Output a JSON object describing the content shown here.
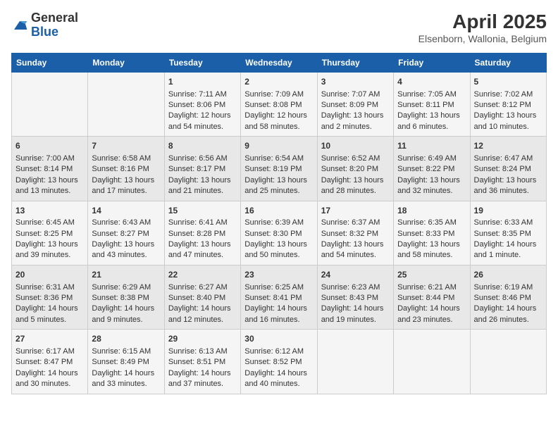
{
  "logo": {
    "general": "General",
    "blue": "Blue"
  },
  "title": "April 2025",
  "subtitle": "Elsenborn, Wallonia, Belgium",
  "days_of_week": [
    "Sunday",
    "Monday",
    "Tuesday",
    "Wednesday",
    "Thursday",
    "Friday",
    "Saturday"
  ],
  "weeks": [
    [
      {
        "day": "",
        "content": ""
      },
      {
        "day": "",
        "content": ""
      },
      {
        "day": "1",
        "content": "Sunrise: 7:11 AM\nSunset: 8:06 PM\nDaylight: 12 hours\nand 54 minutes."
      },
      {
        "day": "2",
        "content": "Sunrise: 7:09 AM\nSunset: 8:08 PM\nDaylight: 12 hours\nand 58 minutes."
      },
      {
        "day": "3",
        "content": "Sunrise: 7:07 AM\nSunset: 8:09 PM\nDaylight: 13 hours\nand 2 minutes."
      },
      {
        "day": "4",
        "content": "Sunrise: 7:05 AM\nSunset: 8:11 PM\nDaylight: 13 hours\nand 6 minutes."
      },
      {
        "day": "5",
        "content": "Sunrise: 7:02 AM\nSunset: 8:12 PM\nDaylight: 13 hours\nand 10 minutes."
      }
    ],
    [
      {
        "day": "6",
        "content": "Sunrise: 7:00 AM\nSunset: 8:14 PM\nDaylight: 13 hours\nand 13 minutes."
      },
      {
        "day": "7",
        "content": "Sunrise: 6:58 AM\nSunset: 8:16 PM\nDaylight: 13 hours\nand 17 minutes."
      },
      {
        "day": "8",
        "content": "Sunrise: 6:56 AM\nSunset: 8:17 PM\nDaylight: 13 hours\nand 21 minutes."
      },
      {
        "day": "9",
        "content": "Sunrise: 6:54 AM\nSunset: 8:19 PM\nDaylight: 13 hours\nand 25 minutes."
      },
      {
        "day": "10",
        "content": "Sunrise: 6:52 AM\nSunset: 8:20 PM\nDaylight: 13 hours\nand 28 minutes."
      },
      {
        "day": "11",
        "content": "Sunrise: 6:49 AM\nSunset: 8:22 PM\nDaylight: 13 hours\nand 32 minutes."
      },
      {
        "day": "12",
        "content": "Sunrise: 6:47 AM\nSunset: 8:24 PM\nDaylight: 13 hours\nand 36 minutes."
      }
    ],
    [
      {
        "day": "13",
        "content": "Sunrise: 6:45 AM\nSunset: 8:25 PM\nDaylight: 13 hours\nand 39 minutes."
      },
      {
        "day": "14",
        "content": "Sunrise: 6:43 AM\nSunset: 8:27 PM\nDaylight: 13 hours\nand 43 minutes."
      },
      {
        "day": "15",
        "content": "Sunrise: 6:41 AM\nSunset: 8:28 PM\nDaylight: 13 hours\nand 47 minutes."
      },
      {
        "day": "16",
        "content": "Sunrise: 6:39 AM\nSunset: 8:30 PM\nDaylight: 13 hours\nand 50 minutes."
      },
      {
        "day": "17",
        "content": "Sunrise: 6:37 AM\nSunset: 8:32 PM\nDaylight: 13 hours\nand 54 minutes."
      },
      {
        "day": "18",
        "content": "Sunrise: 6:35 AM\nSunset: 8:33 PM\nDaylight: 13 hours\nand 58 minutes."
      },
      {
        "day": "19",
        "content": "Sunrise: 6:33 AM\nSunset: 8:35 PM\nDaylight: 14 hours\nand 1 minute."
      }
    ],
    [
      {
        "day": "20",
        "content": "Sunrise: 6:31 AM\nSunset: 8:36 PM\nDaylight: 14 hours\nand 5 minutes."
      },
      {
        "day": "21",
        "content": "Sunrise: 6:29 AM\nSunset: 8:38 PM\nDaylight: 14 hours\nand 9 minutes."
      },
      {
        "day": "22",
        "content": "Sunrise: 6:27 AM\nSunset: 8:40 PM\nDaylight: 14 hours\nand 12 minutes."
      },
      {
        "day": "23",
        "content": "Sunrise: 6:25 AM\nSunset: 8:41 PM\nDaylight: 14 hours\nand 16 minutes."
      },
      {
        "day": "24",
        "content": "Sunrise: 6:23 AM\nSunset: 8:43 PM\nDaylight: 14 hours\nand 19 minutes."
      },
      {
        "day": "25",
        "content": "Sunrise: 6:21 AM\nSunset: 8:44 PM\nDaylight: 14 hours\nand 23 minutes."
      },
      {
        "day": "26",
        "content": "Sunrise: 6:19 AM\nSunset: 8:46 PM\nDaylight: 14 hours\nand 26 minutes."
      }
    ],
    [
      {
        "day": "27",
        "content": "Sunrise: 6:17 AM\nSunset: 8:47 PM\nDaylight: 14 hours\nand 30 minutes."
      },
      {
        "day": "28",
        "content": "Sunrise: 6:15 AM\nSunset: 8:49 PM\nDaylight: 14 hours\nand 33 minutes."
      },
      {
        "day": "29",
        "content": "Sunrise: 6:13 AM\nSunset: 8:51 PM\nDaylight: 14 hours\nand 37 minutes."
      },
      {
        "day": "30",
        "content": "Sunrise: 6:12 AM\nSunset: 8:52 PM\nDaylight: 14 hours\nand 40 minutes."
      },
      {
        "day": "",
        "content": ""
      },
      {
        "day": "",
        "content": ""
      },
      {
        "day": "",
        "content": ""
      }
    ]
  ]
}
